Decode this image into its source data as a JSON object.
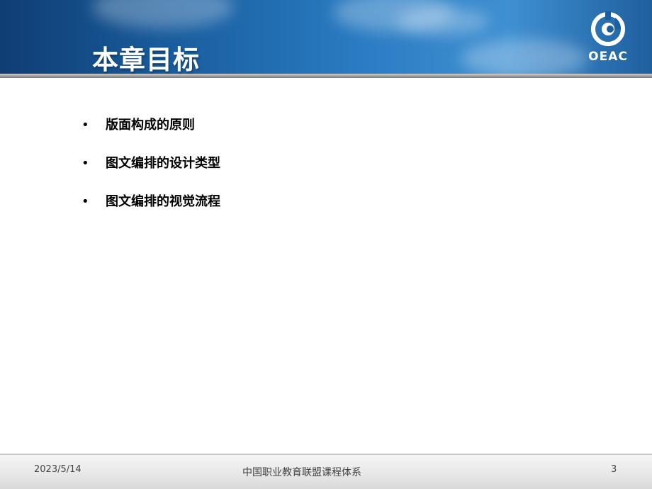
{
  "slide": {
    "title": "本章目标",
    "logo_text": "OEAC",
    "bullets": [
      {
        "marker": "•",
        "text": "版面构成的原则"
      },
      {
        "marker": "•",
        "text": "图文编排的设计类型"
      },
      {
        "marker": "•",
        "text": "图文编排的视觉流程"
      }
    ]
  },
  "footer": {
    "date": "2023/5/14",
    "center_text": "中国职业教育联盟课程体系",
    "page_number": "3"
  },
  "colors": {
    "header_blue": "#1a5fa0",
    "title_text": "#ffffff",
    "body_text": "#000000",
    "footer_text": "#444444"
  },
  "icons": {
    "logo": "oeac-logo-icon"
  }
}
